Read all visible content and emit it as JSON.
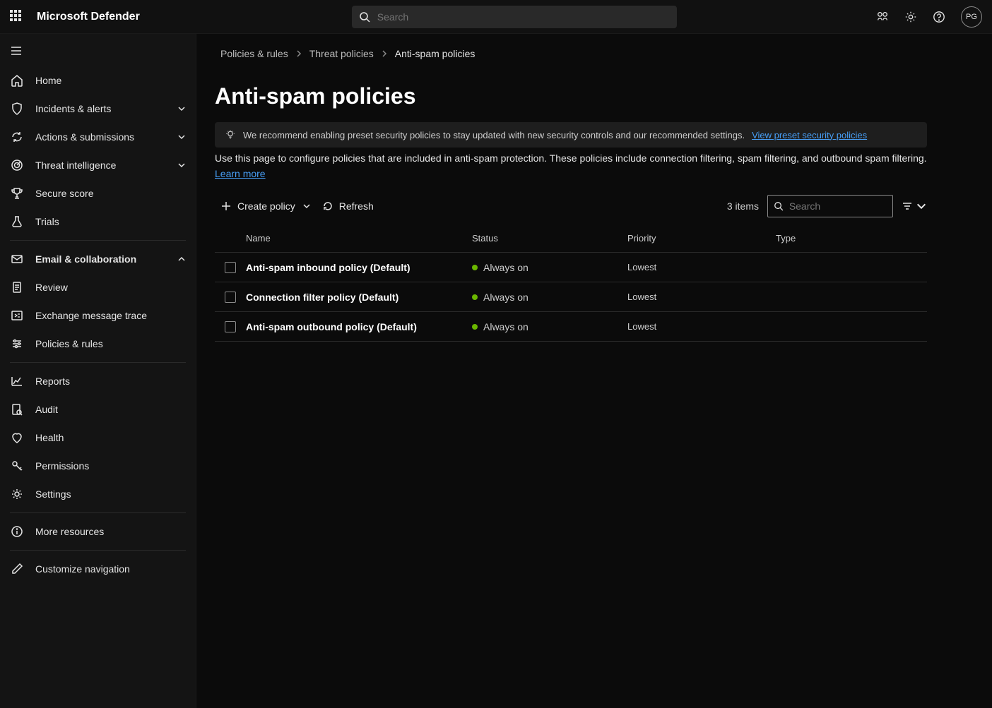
{
  "app": {
    "title": "Microsoft Defender"
  },
  "search": {
    "placeholder": "Search"
  },
  "avatar": {
    "initials": "PG"
  },
  "sidebar": {
    "items": [
      {
        "label": "Home"
      },
      {
        "label": "Incidents & alerts"
      },
      {
        "label": "Actions & submissions"
      },
      {
        "label": "Threat intelligence"
      },
      {
        "label": "Secure score"
      },
      {
        "label": "Trials"
      },
      {
        "label": "Email & collaboration"
      },
      {
        "label": "Review"
      },
      {
        "label": "Exchange message trace"
      },
      {
        "label": "Policies & rules"
      },
      {
        "label": "Reports"
      },
      {
        "label": "Audit"
      },
      {
        "label": "Health"
      },
      {
        "label": "Permissions"
      },
      {
        "label": "Settings"
      },
      {
        "label": "More resources"
      },
      {
        "label": "Customize navigation"
      }
    ]
  },
  "breadcrumb": {
    "items": [
      {
        "label": "Policies & rules"
      },
      {
        "label": "Threat policies"
      },
      {
        "label": "Anti-spam policies"
      }
    ]
  },
  "page": {
    "title": "Anti-spam policies"
  },
  "reco": {
    "text": "We recommend enabling preset security policies to stay updated with new security controls and our recommended settings.",
    "link": "View preset security policies"
  },
  "desc": {
    "text": "Use this page to configure policies that are included in anti-spam protection. These policies include connection filtering, spam filtering, and outbound spam filtering.",
    "learn_more": "Learn more"
  },
  "toolbar": {
    "create": "Create policy",
    "refresh": "Refresh",
    "items_count": "3 items",
    "search_placeholder": "Search"
  },
  "table": {
    "headers": {
      "name": "Name",
      "status": "Status",
      "priority": "Priority",
      "type": "Type"
    },
    "rows": [
      {
        "name": "Anti-spam inbound policy (Default)",
        "status": "Always on",
        "priority": "Lowest",
        "type": ""
      },
      {
        "name": "Connection filter policy (Default)",
        "status": "Always on",
        "priority": "Lowest",
        "type": ""
      },
      {
        "name": "Anti-spam outbound policy (Default)",
        "status": "Always on",
        "priority": "Lowest",
        "type": ""
      }
    ]
  }
}
